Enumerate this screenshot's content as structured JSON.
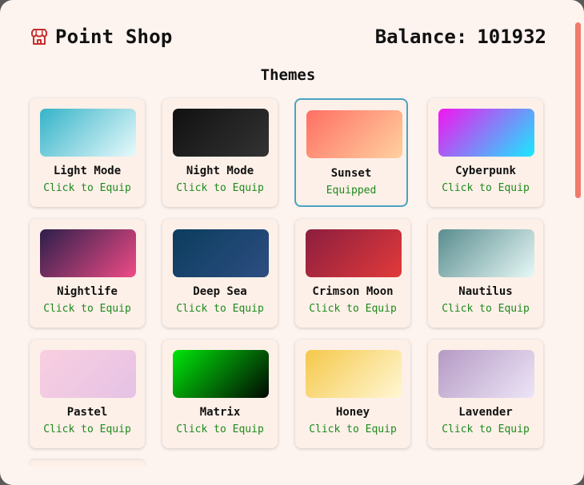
{
  "header": {
    "title": "Point Shop",
    "icon": "shop-icon",
    "balance_label": "Balance:",
    "balance_value": "101932"
  },
  "section": {
    "title": "Themes"
  },
  "colors": {
    "background": "#fdf3ef",
    "card": "#fdf0e8",
    "status_green": "#1d8a1d",
    "equipped_border": "#4aa3c0",
    "scrollbar": "#f07a6c"
  },
  "themes": [
    {
      "name": "Light Mode",
      "status": "Click to Equip",
      "equipped": false,
      "gradient": [
        "#35b3c9",
        "#e8fafb"
      ]
    },
    {
      "name": "Night Mode",
      "status": "Click to Equip",
      "equipped": false,
      "gradient": [
        "#111111",
        "#333333"
      ]
    },
    {
      "name": "Sunset",
      "status": "Equipped",
      "equipped": true,
      "gradient": [
        "#ff6f63",
        "#ffd1a0"
      ]
    },
    {
      "name": "Cyberpunk",
      "status": "Click to Equip",
      "equipped": false,
      "gradient": [
        "#f414f0",
        "#18eaff"
      ]
    },
    {
      "name": "Nightlife",
      "status": "Click to Equip",
      "equipped": false,
      "gradient": [
        "#2c1f4a",
        "#ef4b86"
      ]
    },
    {
      "name": "Deep Sea",
      "status": "Click to Equip",
      "equipped": false,
      "gradient": [
        "#0b3c5d",
        "#2d4e82"
      ]
    },
    {
      "name": "Crimson Moon",
      "status": "Click to Equip",
      "equipped": false,
      "gradient": [
        "#8b1e3f",
        "#e23a3a"
      ]
    },
    {
      "name": "Nautilus",
      "status": "Click to Equip",
      "equipped": false,
      "gradient": [
        "#5a8d8f",
        "#e6f8f6"
      ]
    },
    {
      "name": "Pastel",
      "status": "Click to Equip",
      "equipped": false,
      "gradient": [
        "#f9cfe0",
        "#e5c2e5"
      ]
    },
    {
      "name": "Matrix",
      "status": "Click to Equip",
      "equipped": false,
      "gradient": [
        "#00e60a",
        "#030803"
      ]
    },
    {
      "name": "Honey",
      "status": "Click to Equip",
      "equipped": false,
      "gradient": [
        "#f5c84a",
        "#fff7d4"
      ]
    },
    {
      "name": "Lavender",
      "status": "Click to Equip",
      "equipped": false,
      "gradient": [
        "#b59ac4",
        "#ede5f7"
      ]
    }
  ]
}
